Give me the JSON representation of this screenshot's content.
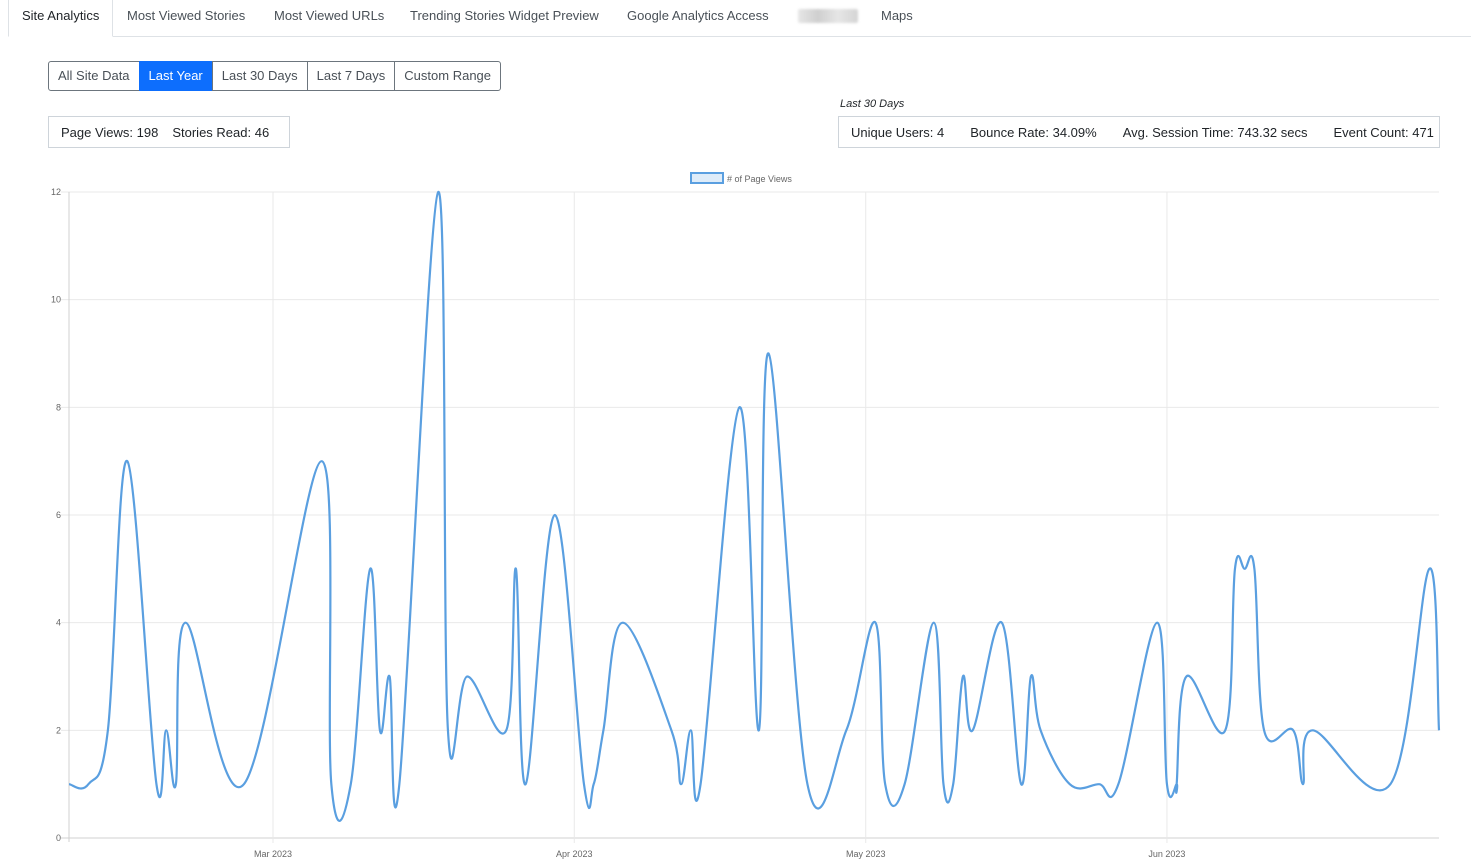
{
  "tabs": [
    {
      "label": "Site Analytics",
      "active": true
    },
    {
      "label": "Most Viewed Stories"
    },
    {
      "label": "Most Viewed URLs"
    },
    {
      "label": "Trending Stories Widget Preview"
    },
    {
      "label": "Google Analytics Access"
    },
    {
      "label": "",
      "blurred": true
    },
    {
      "label": "Maps"
    }
  ],
  "range_buttons": [
    {
      "label": "All Site Data"
    },
    {
      "label": "Last Year",
      "active": true
    },
    {
      "label": "Last 30 Days"
    },
    {
      "label": "Last 7 Days"
    },
    {
      "label": "Custom Range"
    }
  ],
  "stats_left": {
    "page_views": "Page Views: 198",
    "stories_read": "Stories Read: 46"
  },
  "stats_right": {
    "caption": "Last 30 Days",
    "unique_users": "Unique Users: 4",
    "bounce_rate": "Bounce Rate: 34.09%",
    "avg_session": "Avg. Session Time: 743.32 secs",
    "event_count": "Event Count: 471"
  },
  "colors": {
    "line": "#5a9fe0",
    "accent": "#0d6efd",
    "grid": "#e9e9e9"
  },
  "chart_data": {
    "type": "line",
    "legend": "# of Page Views",
    "ylim": [
      0,
      12
    ],
    "y_ticks": [
      0,
      2,
      4,
      6,
      8,
      10,
      12
    ],
    "x_ticks": [
      {
        "label": "Mar 2023",
        "date": "2023-03-01"
      },
      {
        "label": "Apr 2023",
        "date": "2023-04-01"
      },
      {
        "label": "May 2023",
        "date": "2023-05-01"
      },
      {
        "label": "Jun 2023",
        "date": "2023-06-01"
      }
    ],
    "points": [
      {
        "x": "2023-02-08",
        "y": 1
      },
      {
        "x": "2023-02-10",
        "y": 1
      },
      {
        "x": "2023-02-12",
        "y": 2
      },
      {
        "x": "2023-02-14",
        "y": 7
      },
      {
        "x": "2023-02-17",
        "y": 1
      },
      {
        "x": "2023-02-18",
        "y": 2
      },
      {
        "x": "2023-02-19",
        "y": 1
      },
      {
        "x": "2023-02-20",
        "y": 4
      },
      {
        "x": "2023-02-26",
        "y": 1
      },
      {
        "x": "2023-03-06",
        "y": 7
      },
      {
        "x": "2023-03-07",
        "y": 1
      },
      {
        "x": "2023-03-09",
        "y": 1
      },
      {
        "x": "2023-03-11",
        "y": 5
      },
      {
        "x": "2023-03-12",
        "y": 2
      },
      {
        "x": "2023-03-13",
        "y": 3
      },
      {
        "x": "2023-03-14",
        "y": 1
      },
      {
        "x": "2023-03-18",
        "y": 12
      },
      {
        "x": "2023-03-19",
        "y": 2
      },
      {
        "x": "2023-03-21",
        "y": 3
      },
      {
        "x": "2023-03-25",
        "y": 2
      },
      {
        "x": "2023-03-26",
        "y": 5
      },
      {
        "x": "2023-03-27",
        "y": 1
      },
      {
        "x": "2023-03-30",
        "y": 6
      },
      {
        "x": "2023-04-02",
        "y": 1
      },
      {
        "x": "2023-04-03",
        "y": 1
      },
      {
        "x": "2023-04-04",
        "y": 2
      },
      {
        "x": "2023-04-06",
        "y": 4
      },
      {
        "x": "2023-04-11",
        "y": 2
      },
      {
        "x": "2023-04-12",
        "y": 1
      },
      {
        "x": "2023-04-13",
        "y": 2
      },
      {
        "x": "2023-04-14",
        "y": 1
      },
      {
        "x": "2023-04-18",
        "y": 8
      },
      {
        "x": "2023-04-20",
        "y": 2
      },
      {
        "x": "2023-04-21",
        "y": 9
      },
      {
        "x": "2023-04-25",
        "y": 1
      },
      {
        "x": "2023-04-29",
        "y": 2
      },
      {
        "x": "2023-05-02",
        "y": 4
      },
      {
        "x": "2023-05-03",
        "y": 1
      },
      {
        "x": "2023-05-05",
        "y": 1
      },
      {
        "x": "2023-05-08",
        "y": 4
      },
      {
        "x": "2023-05-09",
        "y": 1
      },
      {
        "x": "2023-05-10",
        "y": 1
      },
      {
        "x": "2023-05-11",
        "y": 3
      },
      {
        "x": "2023-05-12",
        "y": 2
      },
      {
        "x": "2023-05-15",
        "y": 4
      },
      {
        "x": "2023-05-17",
        "y": 1
      },
      {
        "x": "2023-05-18",
        "y": 3
      },
      {
        "x": "2023-05-19",
        "y": 2
      },
      {
        "x": "2023-05-22",
        "y": 1
      },
      {
        "x": "2023-05-25",
        "y": 1
      },
      {
        "x": "2023-05-27",
        "y": 1
      },
      {
        "x": "2023-05-31",
        "y": 4
      },
      {
        "x": "2023-06-01",
        "y": 1
      },
      {
        "x": "2023-06-02",
        "y": 1
      },
      {
        "x": "2023-06-02",
        "y": 1
      },
      {
        "x": "2023-06-03",
        "y": 3
      },
      {
        "x": "2023-06-07",
        "y": 2
      },
      {
        "x": "2023-06-08",
        "y": 5
      },
      {
        "x": "2023-06-09",
        "y": 5
      },
      {
        "x": "2023-06-10",
        "y": 5
      },
      {
        "x": "2023-06-11",
        "y": 2
      },
      {
        "x": "2023-06-14",
        "y": 2
      },
      {
        "x": "2023-06-15",
        "y": 1
      },
      {
        "x": "2023-06-16",
        "y": 2
      },
      {
        "x": "2023-06-24",
        "y": 1
      },
      {
        "x": "2023-06-28",
        "y": 5
      },
      {
        "x": "2023-06-29",
        "y": 2
      }
    ]
  }
}
